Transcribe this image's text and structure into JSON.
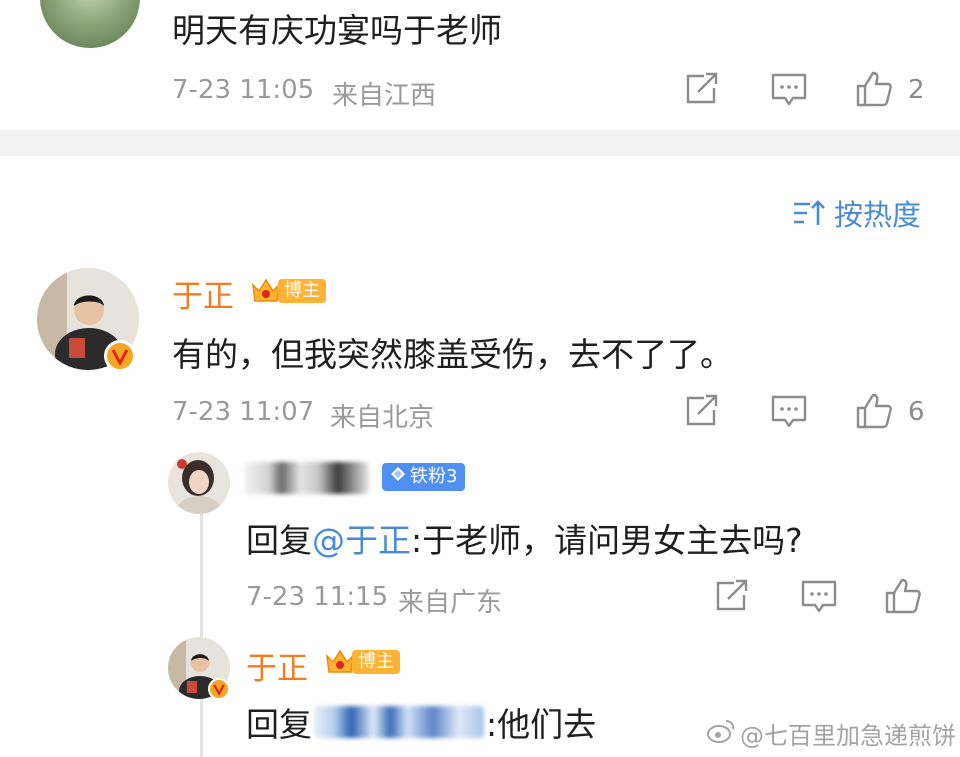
{
  "top_comment": {
    "text": "明天有庆功宴吗于老师",
    "time": "7-23 11:05",
    "location": "来自江西",
    "like_count": "2"
  },
  "sort": {
    "label": "按热度"
  },
  "comment": {
    "author": "于正",
    "badge": "博主",
    "text": "有的，但我突然膝盖受伤，去不了了。",
    "time": "7-23 11:07",
    "location": "来自北京",
    "like_count": "6"
  },
  "replies": [
    {
      "author": "",
      "badge": "铁粉3",
      "reply_prefix": "回复",
      "mention": "@于正",
      "text": ":于老师，请问男女主去吗?",
      "time": "7-23 11:15",
      "location": "来自广东"
    },
    {
      "author": "于正",
      "badge": "博主",
      "reply_prefix": "回复",
      "text": ":他们去"
    }
  ],
  "watermark": "@七百里加急递煎饼",
  "colors": {
    "accent_blue": "#4a8bd6",
    "vip_orange": "#f47b20",
    "separator": "#f2f2f2"
  }
}
